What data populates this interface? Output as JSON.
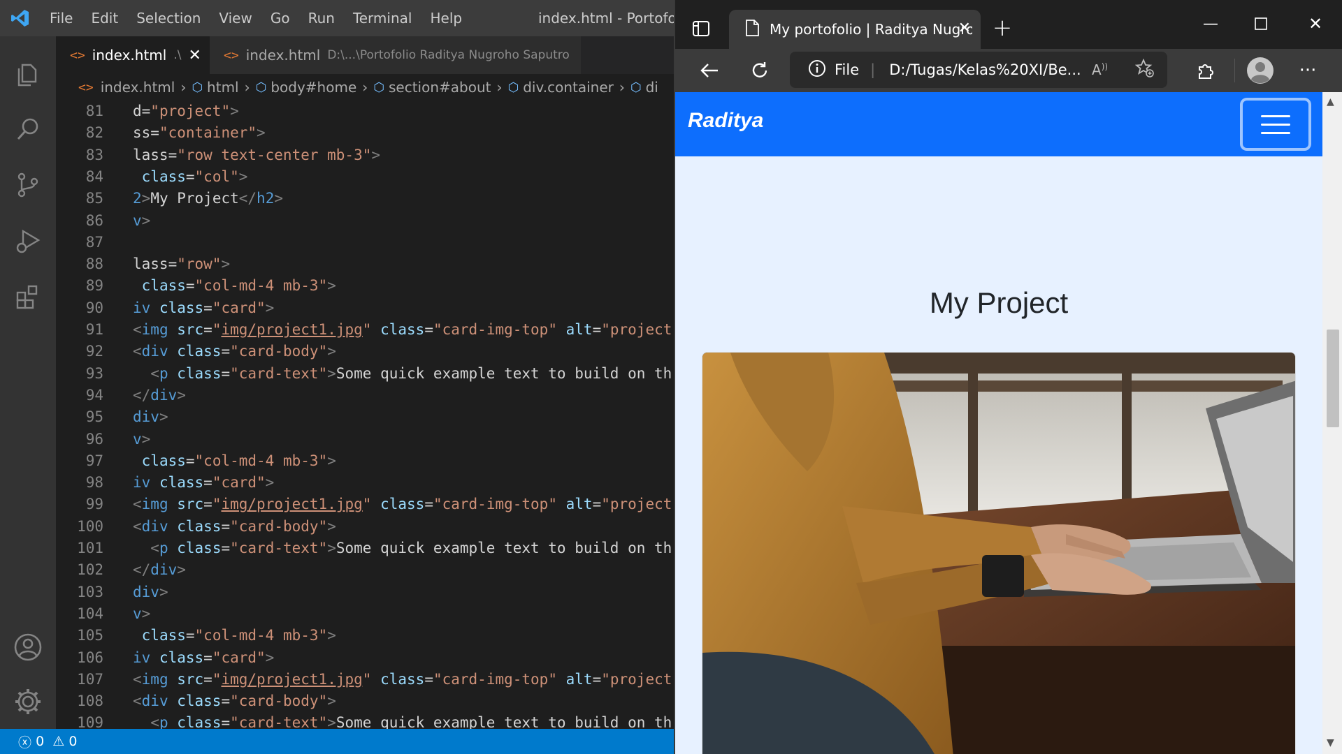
{
  "vscode": {
    "menu": [
      "File",
      "Edit",
      "Selection",
      "View",
      "Go",
      "Run",
      "Terminal",
      "Help"
    ],
    "window_title": "index.html - Portofolio",
    "tabs": [
      {
        "label": "index.html",
        "desc": ".\\",
        "active": true
      },
      {
        "label": "index.html",
        "desc": "D:\\...\\Portofolio Raditya Nugroho Saputro",
        "active": false
      }
    ],
    "breadcrumb": [
      "index.html",
      "html",
      "body#home",
      "section#about",
      "div.container",
      "di"
    ],
    "status": {
      "errors": "0",
      "warnings": "0"
    }
  },
  "code_lines": [
    {
      "n": "81",
      "segs": [
        [
          "w",
          "d="
        ],
        [
          "s",
          "\"project\""
        ],
        [
          "t",
          ">"
        ]
      ]
    },
    {
      "n": "82",
      "segs": [
        [
          "w",
          "ss="
        ],
        [
          "s",
          "\"container\""
        ],
        [
          "t",
          ">"
        ]
      ]
    },
    {
      "n": "83",
      "segs": [
        [
          "w",
          "lass="
        ],
        [
          "s",
          "\"row text-center mb-3\""
        ],
        [
          "t",
          ">"
        ]
      ]
    },
    {
      "n": "84",
      "segs": [
        [
          "w",
          " "
        ],
        [
          "p",
          "class"
        ],
        [
          "w",
          "="
        ],
        [
          "s",
          "\"col\""
        ],
        [
          "t",
          ">"
        ]
      ]
    },
    {
      "n": "85",
      "segs": [
        [
          "tn",
          "2"
        ],
        [
          "t",
          ">"
        ],
        [
          "w",
          "My Project"
        ],
        [
          "t",
          "</"
        ],
        [
          "tn",
          "h2"
        ],
        [
          "t",
          ">"
        ]
      ]
    },
    {
      "n": "86",
      "segs": [
        [
          "tn",
          "v"
        ],
        [
          "t",
          ">"
        ]
      ]
    },
    {
      "n": "87",
      "segs": []
    },
    {
      "n": "88",
      "segs": [
        [
          "w",
          "lass="
        ],
        [
          "s",
          "\"row\""
        ],
        [
          "t",
          ">"
        ]
      ]
    },
    {
      "n": "89",
      "segs": [
        [
          "w",
          " "
        ],
        [
          "p",
          "class"
        ],
        [
          "w",
          "="
        ],
        [
          "s",
          "\"col-md-4 mb-3\""
        ],
        [
          "t",
          ">"
        ]
      ]
    },
    {
      "n": "90",
      "segs": [
        [
          "tn",
          "iv "
        ],
        [
          "p",
          "class"
        ],
        [
          "w",
          "="
        ],
        [
          "s",
          "\"card\""
        ],
        [
          "t",
          ">"
        ]
      ]
    },
    {
      "n": "91",
      "segs": [
        [
          "t",
          "<"
        ],
        [
          "tn",
          "img "
        ],
        [
          "p",
          "src"
        ],
        [
          "w",
          "="
        ],
        [
          "s",
          "\""
        ],
        [
          "u",
          "img/project1.jpg"
        ],
        [
          "s",
          "\""
        ],
        [
          "w",
          " "
        ],
        [
          "p",
          "class"
        ],
        [
          "w",
          "="
        ],
        [
          "s",
          "\"card-img-top\""
        ],
        [
          "w",
          " "
        ],
        [
          "p",
          "alt"
        ],
        [
          "w",
          "="
        ],
        [
          "s",
          "\"project"
        ]
      ]
    },
    {
      "n": "92",
      "segs": [
        [
          "t",
          "<"
        ],
        [
          "tn",
          "div "
        ],
        [
          "p",
          "class"
        ],
        [
          "w",
          "="
        ],
        [
          "s",
          "\"card-body\""
        ],
        [
          "t",
          ">"
        ]
      ]
    },
    {
      "n": "93",
      "segs": [
        [
          "w",
          "  "
        ],
        [
          "t",
          "<"
        ],
        [
          "tn",
          "p "
        ],
        [
          "p",
          "class"
        ],
        [
          "w",
          "="
        ],
        [
          "s",
          "\"card-text\""
        ],
        [
          "t",
          ">"
        ],
        [
          "w",
          "Some quick example text to build on th"
        ]
      ]
    },
    {
      "n": "94",
      "segs": [
        [
          "t",
          "</"
        ],
        [
          "tn",
          "div"
        ],
        [
          "t",
          ">"
        ]
      ]
    },
    {
      "n": "95",
      "segs": [
        [
          "tn",
          "div"
        ],
        [
          "t",
          ">"
        ]
      ]
    },
    {
      "n": "96",
      "segs": [
        [
          "tn",
          "v"
        ],
        [
          "t",
          ">"
        ]
      ]
    },
    {
      "n": "97",
      "segs": [
        [
          "w",
          " "
        ],
        [
          "p",
          "class"
        ],
        [
          "w",
          "="
        ],
        [
          "s",
          "\"col-md-4 mb-3\""
        ],
        [
          "t",
          ">"
        ]
      ]
    },
    {
      "n": "98",
      "segs": [
        [
          "tn",
          "iv "
        ],
        [
          "p",
          "class"
        ],
        [
          "w",
          "="
        ],
        [
          "s",
          "\"card\""
        ],
        [
          "t",
          ">"
        ]
      ]
    },
    {
      "n": "99",
      "segs": [
        [
          "t",
          "<"
        ],
        [
          "tn",
          "img "
        ],
        [
          "p",
          "src"
        ],
        [
          "w",
          "="
        ],
        [
          "s",
          "\""
        ],
        [
          "u",
          "img/project1.jpg"
        ],
        [
          "s",
          "\""
        ],
        [
          "w",
          " "
        ],
        [
          "p",
          "class"
        ],
        [
          "w",
          "="
        ],
        [
          "s",
          "\"card-img-top\""
        ],
        [
          "w",
          " "
        ],
        [
          "p",
          "alt"
        ],
        [
          "w",
          "="
        ],
        [
          "s",
          "\"project"
        ]
      ]
    },
    {
      "n": "100",
      "segs": [
        [
          "t",
          "<"
        ],
        [
          "tn",
          "div "
        ],
        [
          "p",
          "class"
        ],
        [
          "w",
          "="
        ],
        [
          "s",
          "\"card-body\""
        ],
        [
          "t",
          ">"
        ]
      ]
    },
    {
      "n": "101",
      "segs": [
        [
          "w",
          "  "
        ],
        [
          "t",
          "<"
        ],
        [
          "tn",
          "p "
        ],
        [
          "p",
          "class"
        ],
        [
          "w",
          "="
        ],
        [
          "s",
          "\"card-text\""
        ],
        [
          "t",
          ">"
        ],
        [
          "w",
          "Some quick example text to build on th"
        ]
      ]
    },
    {
      "n": "102",
      "segs": [
        [
          "t",
          "</"
        ],
        [
          "tn",
          "div"
        ],
        [
          "t",
          ">"
        ]
      ]
    },
    {
      "n": "103",
      "segs": [
        [
          "tn",
          "div"
        ],
        [
          "t",
          ">"
        ]
      ]
    },
    {
      "n": "104",
      "segs": [
        [
          "tn",
          "v"
        ],
        [
          "t",
          ">"
        ]
      ]
    },
    {
      "n": "105",
      "segs": [
        [
          "w",
          " "
        ],
        [
          "p",
          "class"
        ],
        [
          "w",
          "="
        ],
        [
          "s",
          "\"col-md-4 mb-3\""
        ],
        [
          "t",
          ">"
        ]
      ]
    },
    {
      "n": "106",
      "segs": [
        [
          "tn",
          "iv "
        ],
        [
          "p",
          "class"
        ],
        [
          "w",
          "="
        ],
        [
          "s",
          "\"card\""
        ],
        [
          "t",
          ">"
        ]
      ]
    },
    {
      "n": "107",
      "segs": [
        [
          "t",
          "<"
        ],
        [
          "tn",
          "img "
        ],
        [
          "p",
          "src"
        ],
        [
          "w",
          "="
        ],
        [
          "s",
          "\""
        ],
        [
          "u",
          "img/project1.jpg"
        ],
        [
          "s",
          "\""
        ],
        [
          "w",
          " "
        ],
        [
          "p",
          "class"
        ],
        [
          "w",
          "="
        ],
        [
          "s",
          "\"card-img-top\""
        ],
        [
          "w",
          " "
        ],
        [
          "p",
          "alt"
        ],
        [
          "w",
          "="
        ],
        [
          "s",
          "\"project"
        ]
      ]
    },
    {
      "n": "108",
      "segs": [
        [
          "t",
          "<"
        ],
        [
          "tn",
          "div "
        ],
        [
          "p",
          "class"
        ],
        [
          "w",
          "="
        ],
        [
          "s",
          "\"card-body\""
        ],
        [
          "t",
          ">"
        ]
      ]
    },
    {
      "n": "109",
      "segs": [
        [
          "w",
          "  "
        ],
        [
          "t",
          "<"
        ],
        [
          "tn",
          "p "
        ],
        [
          "p",
          "class"
        ],
        [
          "w",
          "="
        ],
        [
          "s",
          "\"card-text\""
        ],
        [
          "t",
          ">"
        ],
        [
          "w",
          "Some quick example text to build on th"
        ]
      ]
    }
  ],
  "browser": {
    "tab_title": "My portofolio | Raditya Nugroho Saputro",
    "address_prefix": "File",
    "address": "D:/Tugas/Kelas%20XI/Be...",
    "page": {
      "brand": "Raditya",
      "section_title": "My Project"
    }
  },
  "colors": {
    "vscode_bg": "#1e1e1e",
    "status_bar": "#007acc",
    "navbar": "#0d6efd",
    "page_bg": "#e7f1ff"
  }
}
